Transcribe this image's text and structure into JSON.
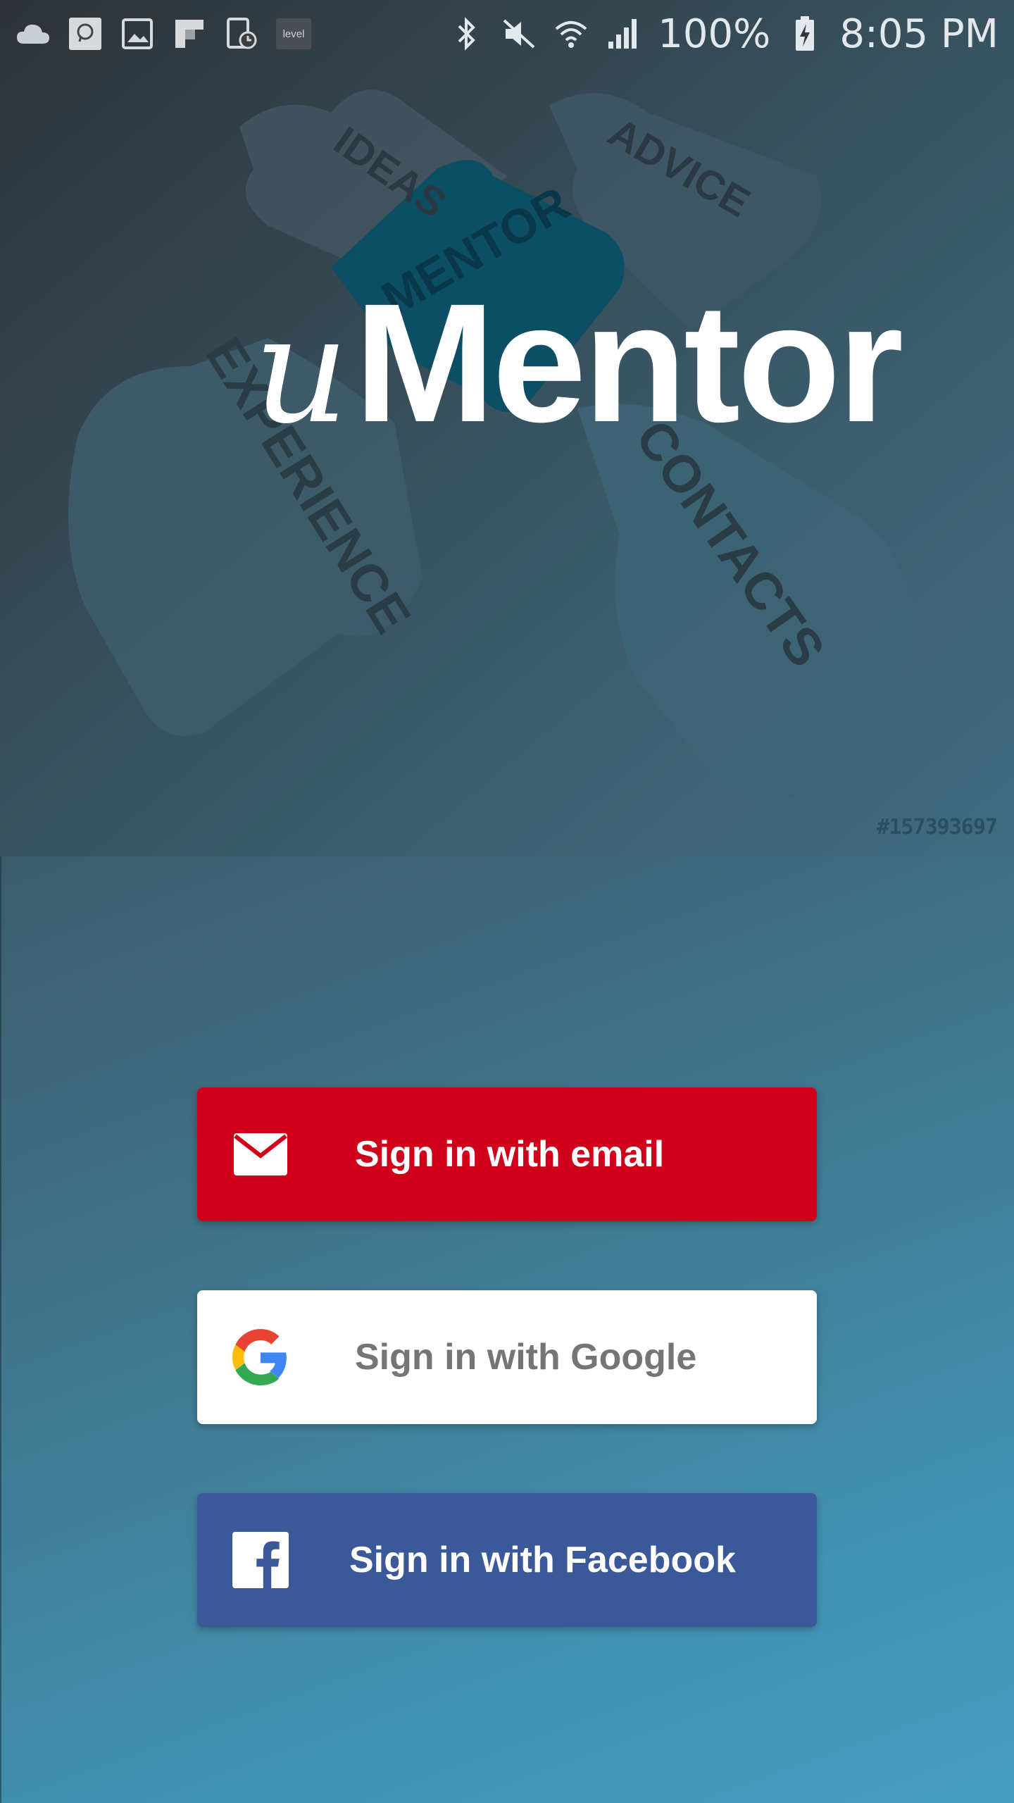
{
  "status_bar": {
    "battery": "100%",
    "time": "8:05 PM",
    "level_app_label": "level",
    "left_icons": [
      "cloud-icon",
      "chat-icon",
      "image-icon",
      "flipboard-icon",
      "tablet-clock-icon",
      "level-icon"
    ],
    "right_icons": [
      "bluetooth-icon",
      "mute-icon",
      "wifi-icon",
      "signal-icon",
      "battery-charging-icon"
    ]
  },
  "hero": {
    "logo_prefix": "u",
    "logo_main": "Mentor",
    "image_id": "#157393697",
    "puzzle_words": [
      "IDEAS",
      "ADVICE",
      "MENTOR",
      "EXPERIENCE",
      "CONTACTS"
    ]
  },
  "auth": {
    "email_label": "Sign in with email",
    "google_label": "Sign in with Google",
    "facebook_label": "Sign in with Facebook"
  },
  "colors": {
    "email": "#d0011b",
    "google": "#ffffff",
    "facebook": "#3b5899",
    "background_top": "#2f3338",
    "background_bottom": "#449dbe"
  }
}
